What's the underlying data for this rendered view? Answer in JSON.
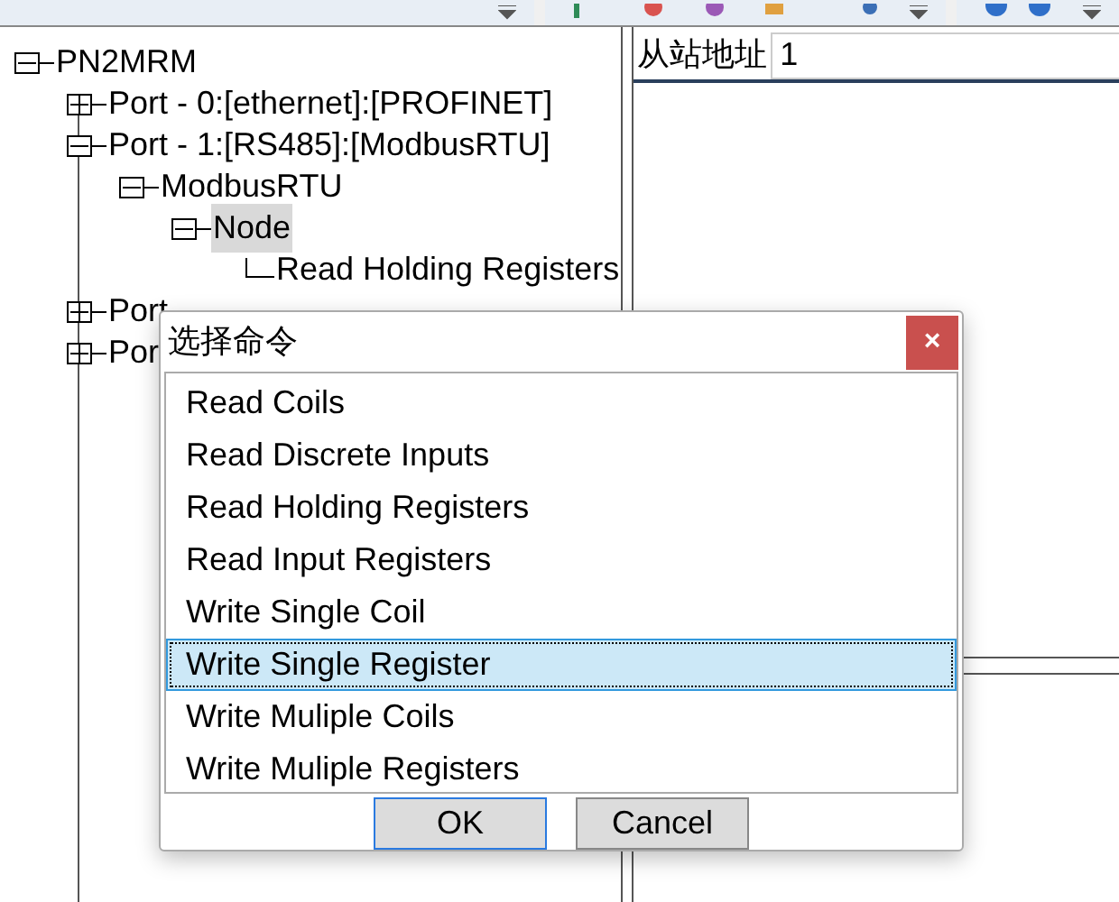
{
  "tree": [
    {
      "label": "PN2MRM",
      "expanded": true,
      "selected": false,
      "children": [
        {
          "label": "Port - 0:[ethernet]:[PROFINET]",
          "expanded": false,
          "selected": false
        },
        {
          "label": "Port - 1:[RS485]:[ModbusRTU]",
          "expanded": true,
          "selected": false,
          "children": [
            {
              "label": "ModbusRTU",
              "expanded": true,
              "selected": false,
              "children": [
                {
                  "label": "Node",
                  "expanded": true,
                  "selected": true,
                  "children": [
                    {
                      "label": "Read Holding Registers",
                      "selected": false
                    }
                  ]
                }
              ]
            }
          ]
        },
        {
          "label": "Port",
          "expanded": false,
          "selected": false
        },
        {
          "label": "Por",
          "expanded": false,
          "selected": false
        }
      ]
    }
  ],
  "properties": {
    "label": "从站地址",
    "value": "1"
  },
  "dialog": {
    "title": "选择命令",
    "close": "×",
    "items": [
      {
        "label": "Read Coils",
        "selected": false
      },
      {
        "label": "Read Discrete Inputs",
        "selected": false
      },
      {
        "label": "Read Holding Registers",
        "selected": false
      },
      {
        "label": "Read Input Registers",
        "selected": false
      },
      {
        "label": "Write Single Coil",
        "selected": false
      },
      {
        "label": "Write Single Register",
        "selected": true
      },
      {
        "label": "Write Muliple Coils",
        "selected": false
      },
      {
        "label": "Write Muliple Registers",
        "selected": false
      }
    ],
    "buttons": [
      {
        "label": "OK",
        "default": true
      },
      {
        "label": "Cancel",
        "default": false
      }
    ]
  }
}
